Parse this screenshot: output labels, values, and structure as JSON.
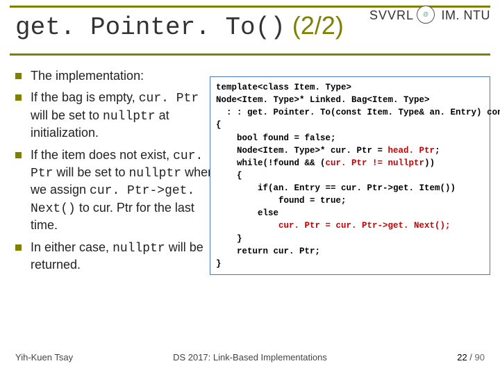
{
  "header": {
    "title_mono": "get. Pointer. To()",
    "title_paren": "(2/2)",
    "svvrl": "SVVRL",
    "at": "@",
    "imntu": "IM. NTU"
  },
  "bullets": [
    {
      "pre": "The implementation:",
      "mono1": "",
      "mid1": "",
      "mono2": "",
      "mid2": "",
      "mono3": "",
      "post": ""
    },
    {
      "pre": "If the bag is empty, ",
      "mono1": "cur. Ptr",
      "mid1": " will be set to ",
      "mono2": "nullptr",
      "mid2": " at initialization.",
      "mono3": "",
      "post": ""
    },
    {
      "pre": "If the item does not exist, ",
      "mono1": "cur. Ptr",
      "mid1": " will be set to ",
      "mono2": "nullptr",
      "mid2": " when we assign ",
      "mono3": "cur. Ptr->get. Next()",
      "post": " to cur. Ptr for the last time."
    },
    {
      "pre": "In either case, ",
      "mono1": "nullptr",
      "mid1": " will be returned.",
      "mono2": "",
      "mid2": "",
      "mono3": "",
      "post": ""
    }
  ],
  "code": {
    "l1": "template<class Item. Type>",
    "l2": "Node<Item. Type>* Linked. Bag<Item. Type>",
    "l3": "  : : get. Pointer. To(const Item. Type& an. Entry) const",
    "l4": "{",
    "l5": "    bool found = false;",
    "l6a": "    Node<Item. Type>* cur. Ptr = ",
    "l6b": "head. Ptr",
    "l6c": ";",
    "l7a": "    while(!found && (",
    "l7b": "cur. Ptr != nullptr",
    "l7c": "))",
    "l8": "    {",
    "l9": "        if(an. Entry == cur. Ptr->get. Item())",
    "l10": "            found = true;",
    "l11": "        else",
    "l12a": "            ",
    "l12b": "cur. Ptr = cur. Ptr->get. Next();",
    "l13": "    }",
    "l14": "    return cur. Ptr;",
    "l15": "}"
  },
  "footer": {
    "author": "Yih-Kuen Tsay",
    "course": "DS 2017: Link-Based Implementations",
    "page_cur": "22",
    "page_sep": " / ",
    "page_tot": "90"
  }
}
